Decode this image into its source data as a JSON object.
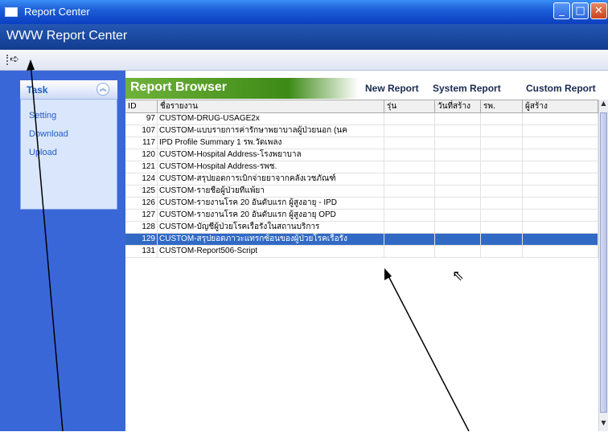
{
  "window": {
    "title": "Report Center",
    "controls": [
      "minimize",
      "maximize",
      "close"
    ]
  },
  "app_header": {
    "title": "WWW Report Center"
  },
  "toolbar": {
    "icon": "arrow-right-icon"
  },
  "task_panel": {
    "title": "Task",
    "links": [
      "Setting",
      "Download",
      "Upload"
    ]
  },
  "report_browser": {
    "title": "Report Browser",
    "buttons": [
      "New Report",
      "System Report",
      "Custom Report"
    ],
    "columns": [
      "ID",
      "ชื่อรายงาน",
      "รุ่น",
      "วันที่สร้าง",
      "รพ.",
      "ผู้สร้าง"
    ],
    "rows": [
      {
        "id": "97",
        "name": "CUSTOM-DRUG-USAGE2x"
      },
      {
        "id": "107",
        "name": "CUSTOM-แบบรายการค่ารักษาพยาบาลผู้ป่วยนอก (นค"
      },
      {
        "id": "117",
        "name": "IPD Profile Summary 1 รพ.วัดเพลง"
      },
      {
        "id": "120",
        "name": "CUSTOM-Hospital Address-โรงพยาบาล"
      },
      {
        "id": "121",
        "name": "CUSTOM-Hospital Address-รพช."
      },
      {
        "id": "124",
        "name": "CUSTOM-สรุปยอดการเบิกจ่ายยาจากคลังเวชภัณฑ์"
      },
      {
        "id": "125",
        "name": "CUSTOM-รายชื่อผู้ป่วยที่แพ้ยา"
      },
      {
        "id": "126",
        "name": "CUSTOM-รายงานโรค 20 อันดับแรก ผู้สูงอายุ - IPD"
      },
      {
        "id": "127",
        "name": "CUSTOM-รายงานโรค 20 อันดับแรก ผู้สูงอายุ OPD"
      },
      {
        "id": "128",
        "name": "CUSTOM-บัญชีผู้ป่วยโรคเรื้อรังในสถานบริการ"
      },
      {
        "id": "129",
        "name": "CUSTOM-สรุปยอดภาวะแทรกซ้อนของผู้ป่วยโรคเรื้อรัง"
      },
      {
        "id": "131",
        "name": "CUSTOM-Report506-Script"
      }
    ],
    "selected_row": 10
  }
}
